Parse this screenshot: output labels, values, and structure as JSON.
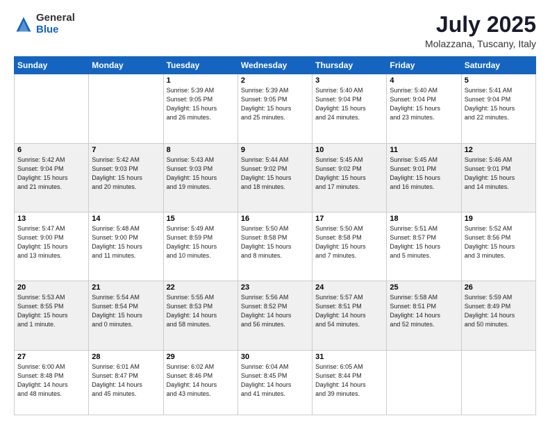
{
  "logo": {
    "general": "General",
    "blue": "Blue"
  },
  "header": {
    "month_year": "July 2025",
    "location": "Molazzana, Tuscany, Italy"
  },
  "weekdays": [
    "Sunday",
    "Monday",
    "Tuesday",
    "Wednesday",
    "Thursday",
    "Friday",
    "Saturday"
  ],
  "weeks": [
    [
      {
        "day": "",
        "info": ""
      },
      {
        "day": "",
        "info": ""
      },
      {
        "day": "1",
        "info": "Sunrise: 5:39 AM\nSunset: 9:05 PM\nDaylight: 15 hours\nand 26 minutes."
      },
      {
        "day": "2",
        "info": "Sunrise: 5:39 AM\nSunset: 9:05 PM\nDaylight: 15 hours\nand 25 minutes."
      },
      {
        "day": "3",
        "info": "Sunrise: 5:40 AM\nSunset: 9:04 PM\nDaylight: 15 hours\nand 24 minutes."
      },
      {
        "day": "4",
        "info": "Sunrise: 5:40 AM\nSunset: 9:04 PM\nDaylight: 15 hours\nand 23 minutes."
      },
      {
        "day": "5",
        "info": "Sunrise: 5:41 AM\nSunset: 9:04 PM\nDaylight: 15 hours\nand 22 minutes."
      }
    ],
    [
      {
        "day": "6",
        "info": "Sunrise: 5:42 AM\nSunset: 9:04 PM\nDaylight: 15 hours\nand 21 minutes."
      },
      {
        "day": "7",
        "info": "Sunrise: 5:42 AM\nSunset: 9:03 PM\nDaylight: 15 hours\nand 20 minutes."
      },
      {
        "day": "8",
        "info": "Sunrise: 5:43 AM\nSunset: 9:03 PM\nDaylight: 15 hours\nand 19 minutes."
      },
      {
        "day": "9",
        "info": "Sunrise: 5:44 AM\nSunset: 9:02 PM\nDaylight: 15 hours\nand 18 minutes."
      },
      {
        "day": "10",
        "info": "Sunrise: 5:45 AM\nSunset: 9:02 PM\nDaylight: 15 hours\nand 17 minutes."
      },
      {
        "day": "11",
        "info": "Sunrise: 5:45 AM\nSunset: 9:01 PM\nDaylight: 15 hours\nand 16 minutes."
      },
      {
        "day": "12",
        "info": "Sunrise: 5:46 AM\nSunset: 9:01 PM\nDaylight: 15 hours\nand 14 minutes."
      }
    ],
    [
      {
        "day": "13",
        "info": "Sunrise: 5:47 AM\nSunset: 9:00 PM\nDaylight: 15 hours\nand 13 minutes."
      },
      {
        "day": "14",
        "info": "Sunrise: 5:48 AM\nSunset: 9:00 PM\nDaylight: 15 hours\nand 11 minutes."
      },
      {
        "day": "15",
        "info": "Sunrise: 5:49 AM\nSunset: 8:59 PM\nDaylight: 15 hours\nand 10 minutes."
      },
      {
        "day": "16",
        "info": "Sunrise: 5:50 AM\nSunset: 8:58 PM\nDaylight: 15 hours\nand 8 minutes."
      },
      {
        "day": "17",
        "info": "Sunrise: 5:50 AM\nSunset: 8:58 PM\nDaylight: 15 hours\nand 7 minutes."
      },
      {
        "day": "18",
        "info": "Sunrise: 5:51 AM\nSunset: 8:57 PM\nDaylight: 15 hours\nand 5 minutes."
      },
      {
        "day": "19",
        "info": "Sunrise: 5:52 AM\nSunset: 8:56 PM\nDaylight: 15 hours\nand 3 minutes."
      }
    ],
    [
      {
        "day": "20",
        "info": "Sunrise: 5:53 AM\nSunset: 8:55 PM\nDaylight: 15 hours\nand 1 minute."
      },
      {
        "day": "21",
        "info": "Sunrise: 5:54 AM\nSunset: 8:54 PM\nDaylight: 15 hours\nand 0 minutes."
      },
      {
        "day": "22",
        "info": "Sunrise: 5:55 AM\nSunset: 8:53 PM\nDaylight: 14 hours\nand 58 minutes."
      },
      {
        "day": "23",
        "info": "Sunrise: 5:56 AM\nSunset: 8:52 PM\nDaylight: 14 hours\nand 56 minutes."
      },
      {
        "day": "24",
        "info": "Sunrise: 5:57 AM\nSunset: 8:51 PM\nDaylight: 14 hours\nand 54 minutes."
      },
      {
        "day": "25",
        "info": "Sunrise: 5:58 AM\nSunset: 8:51 PM\nDaylight: 14 hours\nand 52 minutes."
      },
      {
        "day": "26",
        "info": "Sunrise: 5:59 AM\nSunset: 8:49 PM\nDaylight: 14 hours\nand 50 minutes."
      }
    ],
    [
      {
        "day": "27",
        "info": "Sunrise: 6:00 AM\nSunset: 8:48 PM\nDaylight: 14 hours\nand 48 minutes."
      },
      {
        "day": "28",
        "info": "Sunrise: 6:01 AM\nSunset: 8:47 PM\nDaylight: 14 hours\nand 45 minutes."
      },
      {
        "day": "29",
        "info": "Sunrise: 6:02 AM\nSunset: 8:46 PM\nDaylight: 14 hours\nand 43 minutes."
      },
      {
        "day": "30",
        "info": "Sunrise: 6:04 AM\nSunset: 8:45 PM\nDaylight: 14 hours\nand 41 minutes."
      },
      {
        "day": "31",
        "info": "Sunrise: 6:05 AM\nSunset: 8:44 PM\nDaylight: 14 hours\nand 39 minutes."
      },
      {
        "day": "",
        "info": ""
      },
      {
        "day": "",
        "info": ""
      }
    ]
  ]
}
